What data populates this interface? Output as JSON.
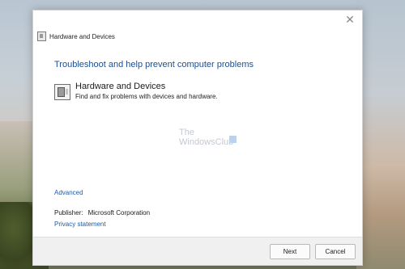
{
  "window": {
    "title": "Hardware and Devices",
    "close_glyph": "✕"
  },
  "main": {
    "heading": "Troubleshoot and help prevent computer problems",
    "item": {
      "title": "Hardware and Devices",
      "description": "Find and fix problems with devices and hardware."
    },
    "watermark": {
      "line1": "The",
      "line2": "WindowsClub"
    },
    "advanced_link": "Advanced",
    "publisher_label": "Publisher:",
    "publisher_value": "Microsoft Corporation",
    "privacy_link": "Privacy statement"
  },
  "footer": {
    "next_label": "Next",
    "cancel_label": "Cancel"
  },
  "colors": {
    "accent_text": "#1e4f91",
    "link": "#1e5ba8"
  }
}
